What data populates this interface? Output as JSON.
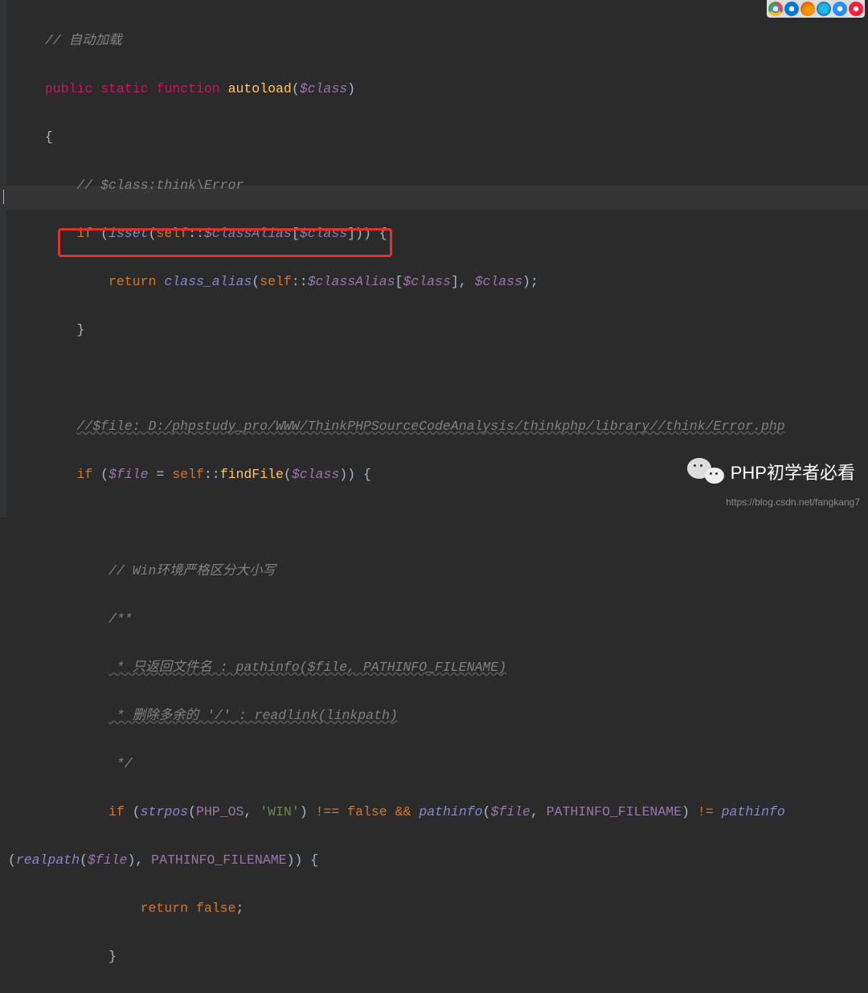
{
  "comments": {
    "autoload": "// 自动加载",
    "class_note": "// $class:think\\Error",
    "file_note": "//$file: D:/phpstudy_pro/WWW/ThinkPHPSourceCodeAnalysis/thinkphp/library//think/Error.php",
    "win_note": "// Win环境严格区分大小写",
    "doc_start": "/**",
    "doc_line1": " * 只返回文件名 : pathinfo($file, PATHINFO_FILENAME)",
    "doc_line2": " * 删除多余的 '/' : readlink(linkpath)",
    "doc_end": " */"
  },
  "keywords": {
    "public": "public",
    "static": "static",
    "function": "function",
    "if": "if",
    "return": "return",
    "isset": "isset",
    "self": "self",
    "false": "false"
  },
  "identifiers": {
    "autoload": "autoload",
    "class": "$class",
    "classAlias": "$classAlias",
    "class_alias": "class_alias",
    "file": "$file",
    "findFile": "findFile",
    "strpos": "strpos",
    "PHP_OS": "PHP_OS",
    "WIN": "'WIN'",
    "pathinfo": "pathinfo",
    "PATHINFO_FILENAME": "PATHINFO_FILENAME",
    "realpath": "realpath"
  },
  "ops": {
    "noteq": "!==",
    "and": "&&",
    "noteq2": "!=",
    "scope": "::",
    "assign": "="
  },
  "badge": {
    "text": "PHP初学者必看"
  },
  "footer": {
    "url": "https://blog.csdn.net/fangkang7"
  },
  "highlight": {
    "red_box_target_line": 10
  }
}
